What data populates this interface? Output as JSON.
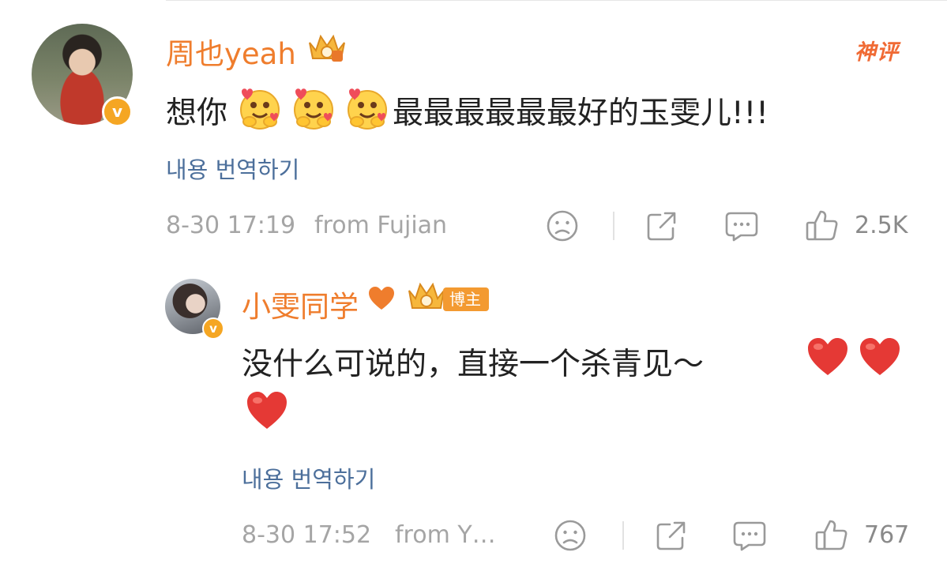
{
  "comment": {
    "username": "周也yeah",
    "badge": "神评",
    "text_prefix": "想你",
    "emoji": "hugging-face-with-hearts",
    "emoji_count": 3,
    "text_suffix": "最最最最最最好的玉雯儿!!!",
    "translate_label": "내용 번역하기",
    "timestamp": "8-30 17:19",
    "location": "from Fujian",
    "likes": "2.5K"
  },
  "reply": {
    "username": "小雯同学",
    "badge": "博主",
    "text_line1": "没什么可说的，直接一个杀青见～",
    "hearts_line1": 2,
    "hearts_line2": 1,
    "translate_label": "내용 번역하기",
    "timestamp": "8-30 17:52",
    "location": "from Y…",
    "likes": "767"
  },
  "colors": {
    "username": "#ef7d2d",
    "translate_link": "#4c6f9b",
    "meta": "#a5a5a5",
    "heart": "#e53935",
    "badge": "#f39a31"
  }
}
